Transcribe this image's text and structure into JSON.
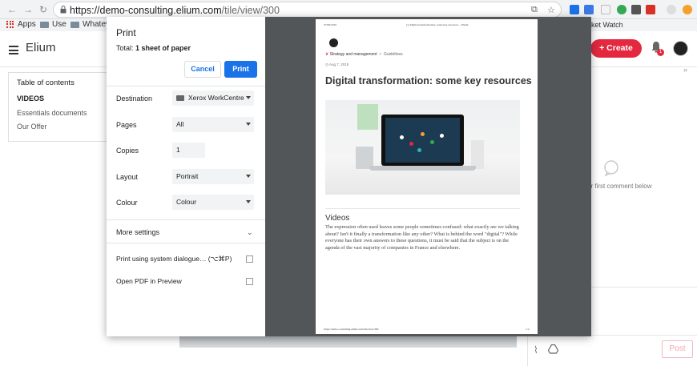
{
  "browser": {
    "url_host": "https://demo-consulting.elium.com",
    "url_path": "/tile/view/300",
    "bookmarks": [
      {
        "label": "Apps"
      },
      {
        "label": "Use"
      },
      {
        "label": "Whatevr"
      }
    ],
    "icons": [
      "back-icon",
      "forward-icon",
      "reload-icon",
      "lock-icon",
      "translate-icon",
      "star-icon"
    ]
  },
  "app": {
    "brand": "Elium",
    "market_watch": "rket Watch",
    "create_label": "+ Create",
    "notification_count": "1",
    "toc": {
      "title": "Table of contents",
      "items": [
        "VIDEOS",
        "Essentials documents",
        "Our Offer"
      ]
    },
    "comment_placeholder": "ur first comment below",
    "post_label": "Post"
  },
  "print": {
    "title": "Print",
    "total_prefix": "Total:",
    "total_value": "1 sheet of paper",
    "cancel_label": "Cancel",
    "print_label": "Print",
    "destination_label": "Destination",
    "destination_value": "Xerox WorkCentre",
    "pages_label": "Pages",
    "pages_value": "All",
    "copies_label": "Copies",
    "copies_value": "1",
    "layout_label": "Layout",
    "layout_value": "Portrait",
    "colour_label": "Colour",
    "colour_value": "Colour",
    "more_settings_label": "More settings",
    "system_dialog_label": "Print using system dialogue… (⌥⌘P)",
    "open_pdf_label": "Open PDF in Preview"
  },
  "preview_page": {
    "header_date": "07/08/2019",
    "header_title": "(1) Digital transformation: some key resources – Elium",
    "breadcrumb_category": "Strategy and management",
    "breadcrumb_sub": "Guidelines",
    "date": "Aug 7, 2019",
    "title": "Digital transformation: some key resources",
    "section_heading": "Videos",
    "body": "The expression often used leaves some people sometimes confused: what exactly are we talking about? Isn't it finally a transformation like any other? What is behind the word \"digital\"? While everyone has their own answers to these questions, it must be said that the subject is on the agenda of the vast majority of companies in France and elsewhere.",
    "footer_url": "https://demo-consulting.elium.com/tile/view/300",
    "footer_page": "1/2"
  },
  "colors": {
    "accent_blue": "#1a73e8",
    "brand_red": "#e3283f",
    "preview_bg": "#525659"
  }
}
